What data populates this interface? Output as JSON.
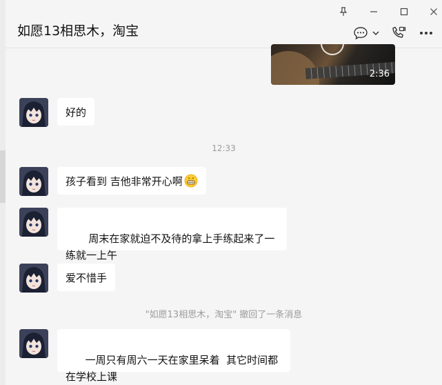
{
  "header": {
    "title": "如愿13相思木，淘宝"
  },
  "window_controls": {
    "pin": "pin-icon",
    "minimize": "minimize-icon",
    "maximize": "maximize-icon",
    "close": "close-icon"
  },
  "chat": {
    "video": {
      "duration": "2:36"
    },
    "messages": [
      {
        "text": "好的"
      },
      {
        "text": "孩子看到 吉他非常开心啊",
        "emoji": "grinning-face-icon"
      },
      {
        "text": " 周末在家就迫不及待的拿上手练起来了一练就一上午"
      },
      {
        "text": "爱不惜手"
      },
      {
        "text": "一周只有周六一天在家里呆着  其它时间都在学校上课"
      }
    ],
    "timestamp": "12:33",
    "recall_notice": "\"如愿13相思木，淘宝\" 撤回了一条消息"
  },
  "colors": {
    "background": "#f5f5f5",
    "bubble": "#ffffff",
    "meta_text": "#9b9b9b"
  }
}
